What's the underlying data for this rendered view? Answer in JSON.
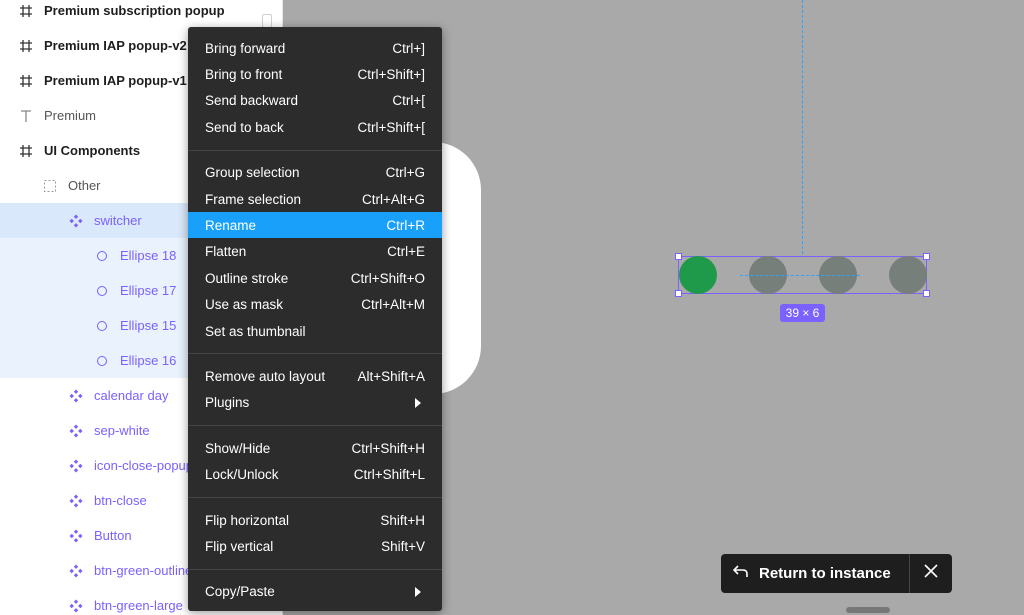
{
  "layers": [
    {
      "label": "Premium subscription popup",
      "kind": "frame",
      "style": "bold",
      "indent": 18
    },
    {
      "label": "Premium IAP popup-v2",
      "kind": "frame",
      "style": "bold",
      "indent": 18
    },
    {
      "label": "Premium IAP popup-v1",
      "kind": "frame",
      "style": "bold",
      "indent": 18
    },
    {
      "label": "Premium",
      "kind": "text",
      "style": "plain",
      "indent": 18
    },
    {
      "label": "UI Components",
      "kind": "frame",
      "style": "bold",
      "indent": 18
    },
    {
      "label": "Other",
      "kind": "group",
      "style": "plain",
      "indent": 42
    },
    {
      "label": "switcher",
      "kind": "component",
      "style": "comp",
      "indent": 68,
      "selected": "parent"
    },
    {
      "label": "Ellipse 18",
      "kind": "ellipse",
      "style": "comp",
      "indent": 94,
      "selected": "child"
    },
    {
      "label": "Ellipse 17",
      "kind": "ellipse",
      "style": "comp",
      "indent": 94,
      "selected": "child"
    },
    {
      "label": "Ellipse 15",
      "kind": "ellipse",
      "style": "comp",
      "indent": 94,
      "selected": "child"
    },
    {
      "label": "Ellipse 16",
      "kind": "ellipse",
      "style": "comp",
      "indent": 94,
      "selected": "child"
    },
    {
      "label": "calendar day",
      "kind": "component",
      "style": "comp",
      "indent": 68
    },
    {
      "label": "sep-white",
      "kind": "component",
      "style": "comp",
      "indent": 68
    },
    {
      "label": "icon-close-popup",
      "kind": "component",
      "style": "comp",
      "indent": 68
    },
    {
      "label": "btn-close",
      "kind": "component",
      "style": "comp",
      "indent": 68
    },
    {
      "label": "Button",
      "kind": "component",
      "style": "comp",
      "indent": 68
    },
    {
      "label": "btn-green-outline",
      "kind": "component",
      "style": "comp",
      "indent": 68
    },
    {
      "label": "btn-green-large",
      "kind": "component",
      "style": "comp",
      "indent": 68
    }
  ],
  "menu": [
    {
      "label": "Bring forward",
      "shortcut": "Ctrl+]"
    },
    {
      "label": "Bring to front",
      "shortcut": "Ctrl+Shift+]"
    },
    {
      "label": "Send backward",
      "shortcut": "Ctrl+["
    },
    {
      "label": "Send to back",
      "shortcut": "Ctrl+Shift+["
    },
    {
      "sep": true
    },
    {
      "label": "Group selection",
      "shortcut": "Ctrl+G"
    },
    {
      "label": "Frame selection",
      "shortcut": "Ctrl+Alt+G"
    },
    {
      "label": "Rename",
      "shortcut": "Ctrl+R",
      "active": true
    },
    {
      "label": "Flatten",
      "shortcut": "Ctrl+E"
    },
    {
      "label": "Outline stroke",
      "shortcut": "Ctrl+Shift+O"
    },
    {
      "label": "Use as mask",
      "shortcut": "Ctrl+Alt+M"
    },
    {
      "label": "Set as thumbnail",
      "shortcut": ""
    },
    {
      "sep": true
    },
    {
      "label": "Remove auto layout",
      "shortcut": "Alt+Shift+A"
    },
    {
      "label": "Plugins",
      "shortcut": "",
      "submenu": true
    },
    {
      "sep": true
    },
    {
      "label": "Show/Hide",
      "shortcut": "Ctrl+Shift+H"
    },
    {
      "label": "Lock/Unlock",
      "shortcut": "Ctrl+Shift+L"
    },
    {
      "sep": true
    },
    {
      "label": "Flip horizontal",
      "shortcut": "Shift+H"
    },
    {
      "label": "Flip vertical",
      "shortcut": "Shift+V"
    },
    {
      "sep": true
    },
    {
      "label": "Copy/Paste",
      "shortcut": "",
      "submenu": true
    }
  ],
  "canvas": {
    "size_badge": "39 × 6",
    "dots": [
      {
        "color": "#1e9a4a"
      },
      {
        "color": "#777f7a"
      },
      {
        "color": "#777f7a"
      },
      {
        "color": "#777f7a"
      }
    ]
  },
  "toast": {
    "label": "Return to instance"
  },
  "colors": {
    "accent": "#18a0fb",
    "component": "#7b61ff",
    "active_dot": "#1e9a4a"
  }
}
